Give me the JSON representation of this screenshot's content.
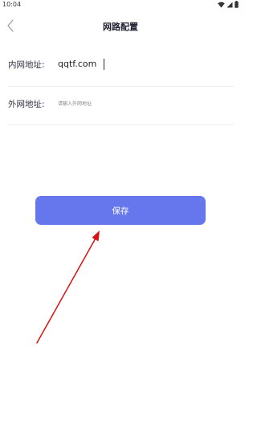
{
  "status_bar": {
    "time": "10:04",
    "icons": [
      "wifi-icon",
      "signal-icon",
      "battery-icon"
    ]
  },
  "nav": {
    "back_icon": "chevron-left-icon",
    "title": "网路配置"
  },
  "form": {
    "internal": {
      "label": "内网地址:",
      "value": "qqtf.com",
      "placeholder": ""
    },
    "external": {
      "label": "外网地址:",
      "value": "",
      "placeholder": "请输入外网地址"
    }
  },
  "actions": {
    "save_label": "保存"
  },
  "colors": {
    "accent": "#6677ee",
    "annotation": "#dd1111",
    "divider": "#eeeeee"
  }
}
